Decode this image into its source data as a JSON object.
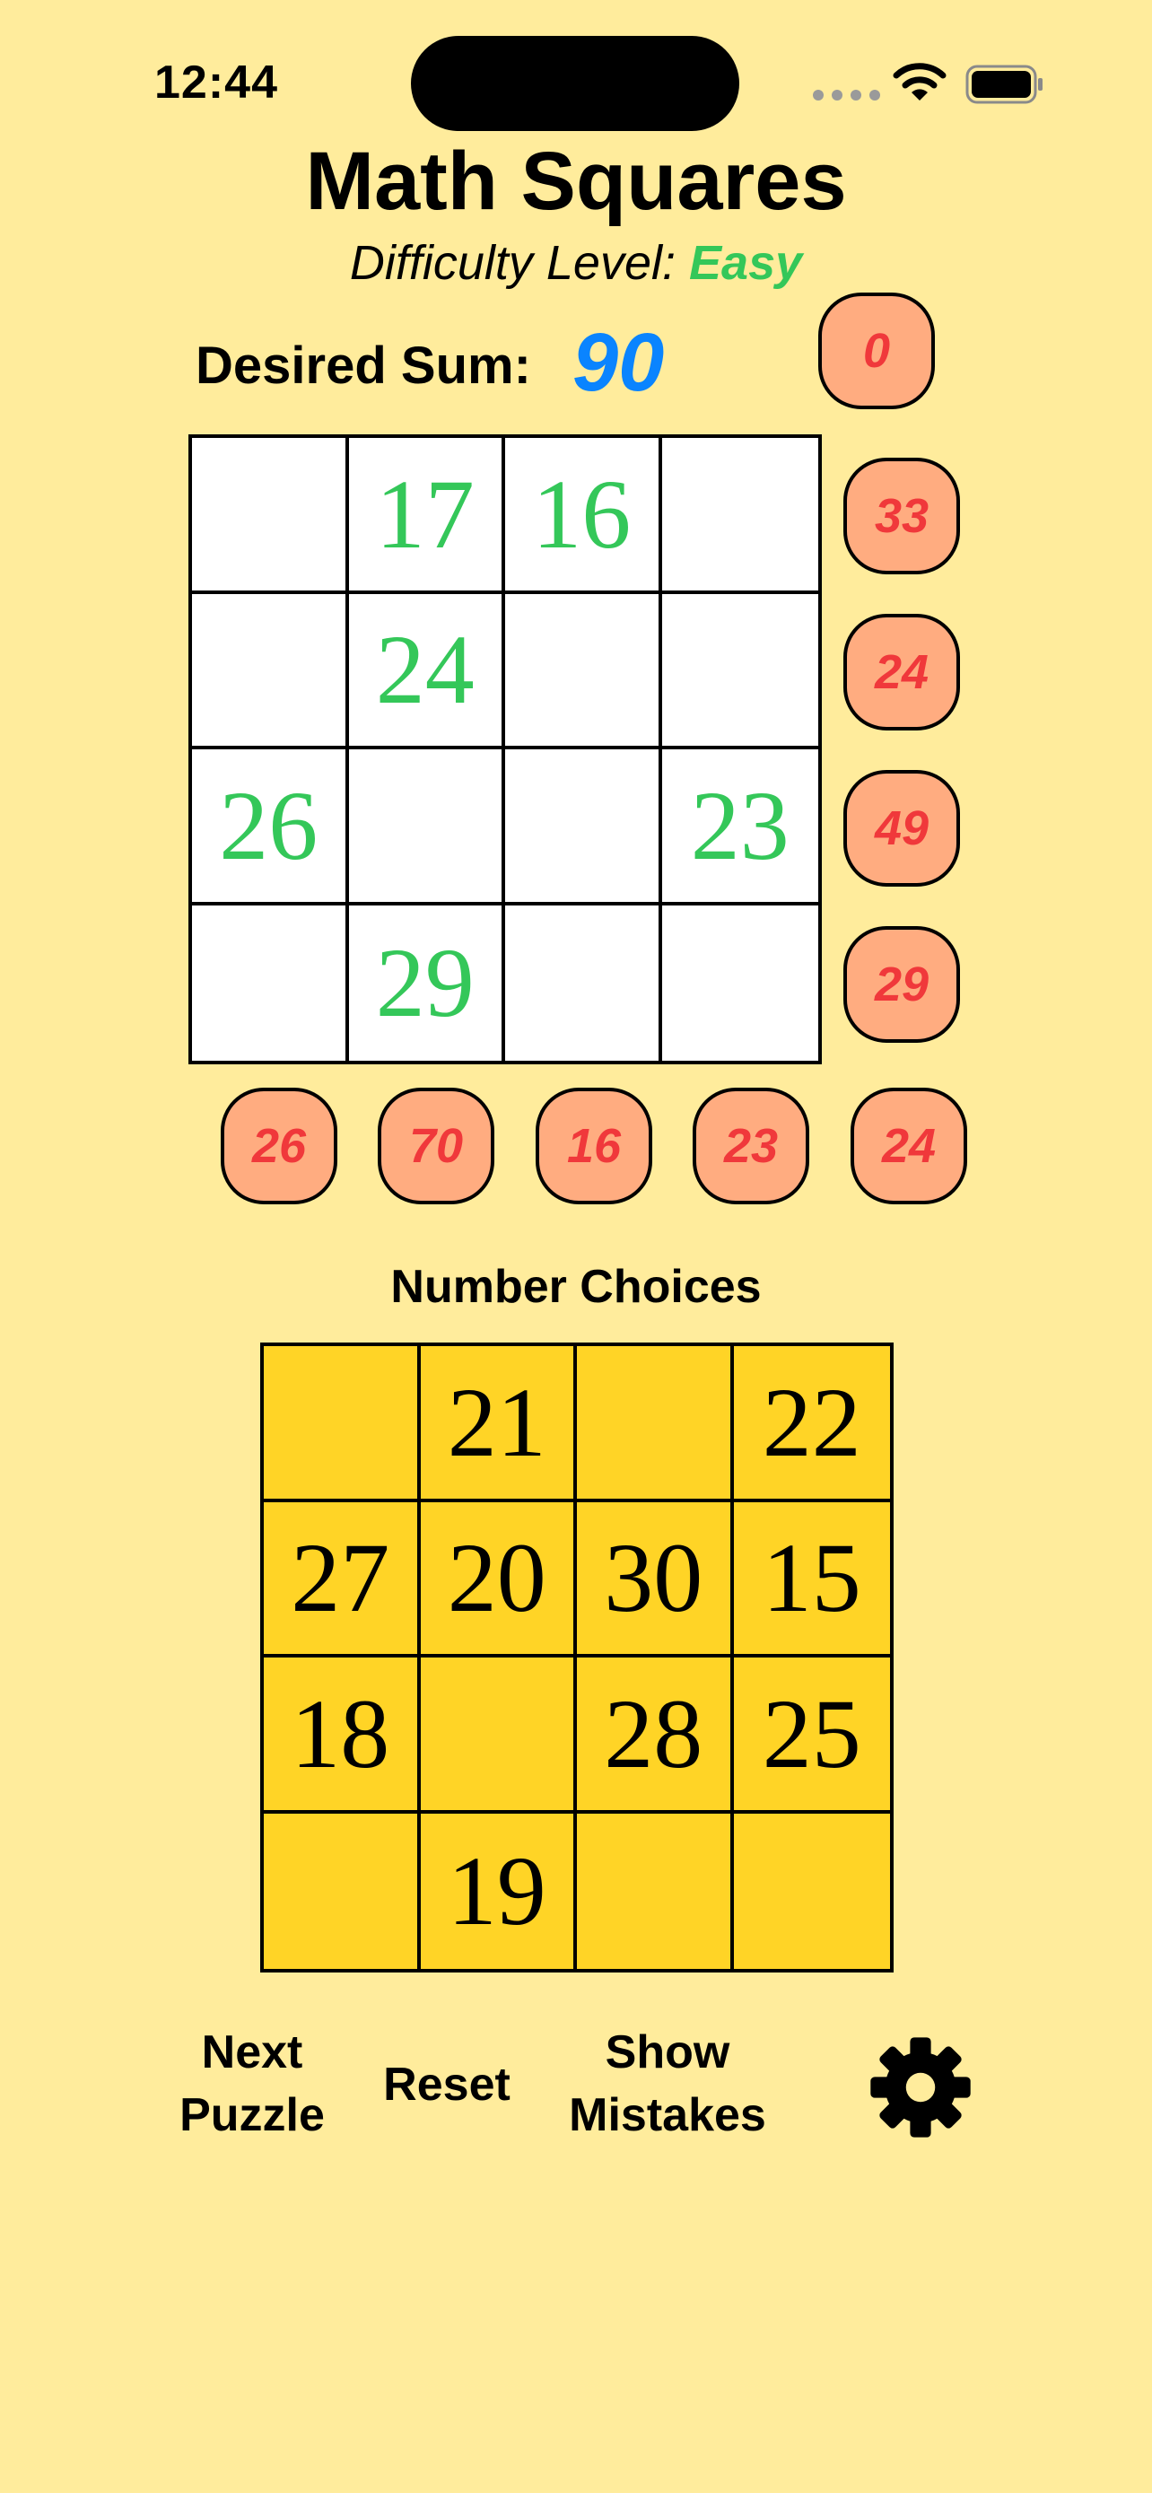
{
  "status_bar": {
    "time": "12:44"
  },
  "header": {
    "title": "Math Squares",
    "difficulty_label": "Difficulty Level:",
    "difficulty_value": "Easy"
  },
  "desired_sum": {
    "label": "Desired Sum:",
    "value": "90"
  },
  "diagonal_sum": "0",
  "row_sums": [
    "33",
    "24",
    "49",
    "29"
  ],
  "column_sums": [
    "26",
    "70",
    "16",
    "23",
    "24"
  ],
  "puzzle_grid": [
    [
      "",
      "17",
      "16",
      ""
    ],
    [
      "",
      "24",
      "",
      ""
    ],
    [
      "26",
      "",
      "",
      "23"
    ],
    [
      "",
      "29",
      "",
      ""
    ]
  ],
  "choices": {
    "title": "Number Choices",
    "grid": [
      [
        "",
        "21",
        "",
        "22"
      ],
      [
        "27",
        "20",
        "30",
        "15"
      ],
      [
        "18",
        "",
        "28",
        "25"
      ],
      [
        "",
        "19",
        "",
        ""
      ]
    ]
  },
  "controls": {
    "next_line1": "Next",
    "next_line2": "Puzzle",
    "reset": "Reset",
    "mistakes_line1": "Show",
    "mistakes_line2": "Mistakes"
  },
  "icons": {
    "settings": "gear-icon",
    "wifi": "wifi-icon",
    "battery": "battery-icon"
  },
  "colors": {
    "background": "#FFEC9C",
    "accent_green": "#34C759",
    "accent_blue": "#0A84FF",
    "bubble_fill": "#FFAC80",
    "bubble_text": "#F0383B",
    "choices_fill": "#FFD426"
  }
}
